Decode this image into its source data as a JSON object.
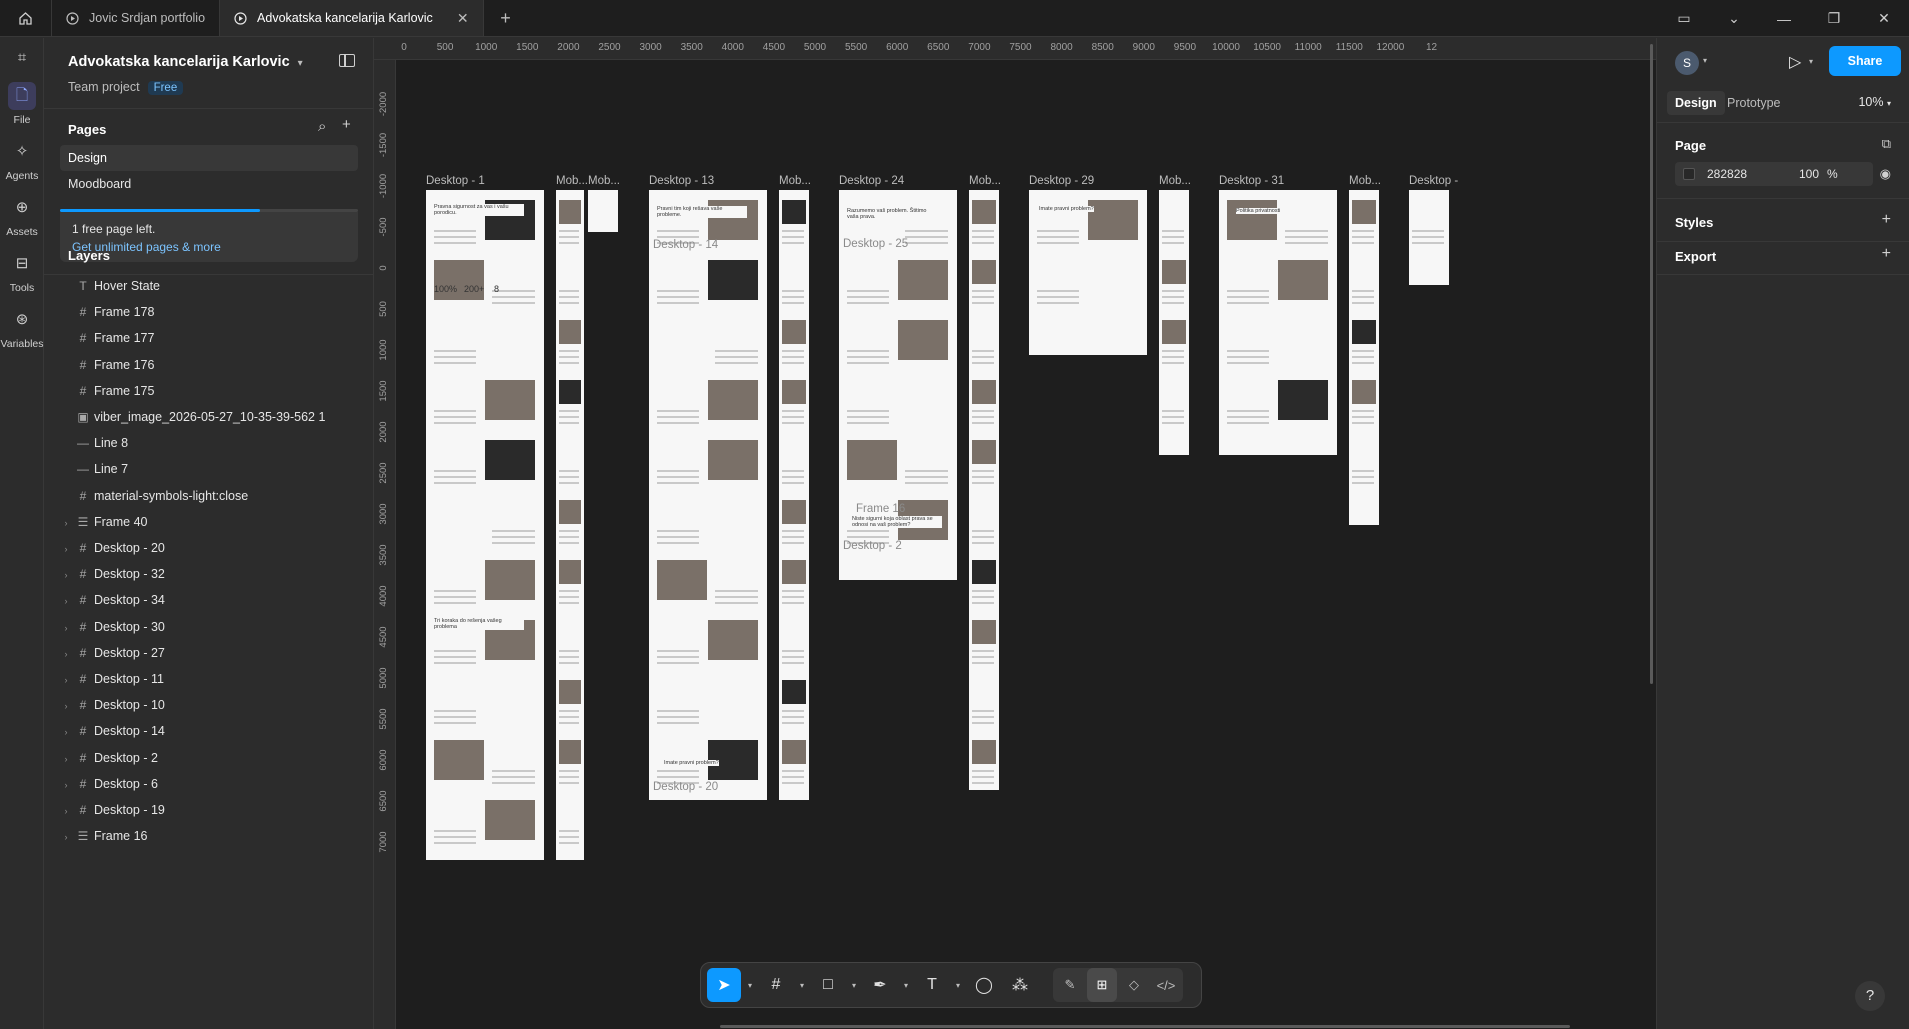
{
  "tabs": [
    {
      "label": "Jovic Srdjan portfolio",
      "active": false
    },
    {
      "label": "Advokatska kancelarija Karlovic",
      "active": true
    }
  ],
  "rail": [
    {
      "label": "File",
      "icon": "file-icon"
    },
    {
      "label": "Agents",
      "icon": "sparkle-icon"
    },
    {
      "label": "Assets",
      "icon": "assets-icon"
    },
    {
      "label": "Tools",
      "icon": "toolbox-icon"
    },
    {
      "label": "Variables",
      "icon": "variables-icon"
    }
  ],
  "project": {
    "title": "Advokatska kancelarija Karlovic",
    "team": "Team project",
    "plan_badge": "Free"
  },
  "pages": {
    "title": "Pages",
    "items": [
      "Design",
      "Moodboard"
    ],
    "active": "Design",
    "usage_fraction": 0.67,
    "notice_line1": "1 free page left.",
    "notice_link": "Get unlimited pages & more"
  },
  "layers": {
    "title": "Layers",
    "items": [
      {
        "name": "Hover State",
        "type": "text",
        "expandable": false
      },
      {
        "name": "Frame 178",
        "type": "frame",
        "expandable": false
      },
      {
        "name": "Frame 177",
        "type": "frame",
        "expandable": false
      },
      {
        "name": "Frame 176",
        "type": "frame",
        "expandable": false
      },
      {
        "name": "Frame 175",
        "type": "frame",
        "expandable": false
      },
      {
        "name": "viber_image_2026-05-27_10-35-39-562 1",
        "type": "image",
        "expandable": false
      },
      {
        "name": "Line 8",
        "type": "line",
        "expandable": false
      },
      {
        "name": "Line 7",
        "type": "line",
        "expandable": false
      },
      {
        "name": "material-symbols-light:close",
        "type": "frame",
        "expandable": false
      },
      {
        "name": "Frame 40",
        "type": "autolayout",
        "expandable": true
      },
      {
        "name": "Desktop - 20",
        "type": "frame",
        "expandable": true
      },
      {
        "name": "Desktop - 32",
        "type": "frame",
        "expandable": true
      },
      {
        "name": "Desktop - 34",
        "type": "frame",
        "expandable": true
      },
      {
        "name": "Desktop - 30",
        "type": "frame",
        "expandable": true
      },
      {
        "name": "Desktop - 27",
        "type": "frame",
        "expandable": true
      },
      {
        "name": "Desktop - 11",
        "type": "frame",
        "expandable": true
      },
      {
        "name": "Desktop - 10",
        "type": "frame",
        "expandable": true
      },
      {
        "name": "Desktop - 14",
        "type": "frame",
        "expandable": true
      },
      {
        "name": "Desktop - 2",
        "type": "frame",
        "expandable": true
      },
      {
        "name": "Desktop - 6",
        "type": "frame",
        "expandable": true
      },
      {
        "name": "Desktop - 19",
        "type": "frame",
        "expandable": true
      },
      {
        "name": "Frame 16",
        "type": "autolayout",
        "expandable": true
      }
    ]
  },
  "ruler": {
    "h": [
      "0",
      "500",
      "1000",
      "1500",
      "2000",
      "2500",
      "3000",
      "3500",
      "4000",
      "4500",
      "5000",
      "5500",
      "6000",
      "6500",
      "7000",
      "7500",
      "8000",
      "8500",
      "9000",
      "9500",
      "10000",
      "10500",
      "11000",
      "11500",
      "12000",
      "12"
    ],
    "v": [
      "-2000",
      "-1500",
      "-1000",
      "-500",
      "0",
      "500",
      "1000",
      "1500",
      "2000",
      "2500",
      "3000",
      "3500",
      "4000",
      "4500",
      "5000",
      "5500",
      "6000",
      "6500",
      "7000"
    ]
  },
  "canvas_frames": {
    "labels": [
      "Desktop - 1",
      "Mob...",
      "Mob...",
      "Desktop - 13",
      "Mob...",
      "Desktop - 24",
      "Mob...",
      "Desktop - 29",
      "Mob...",
      "Desktop - 31",
      "Mob...",
      "Desktop -"
    ],
    "overlay_labels": [
      "Desktop - 14",
      "Desktop - 25",
      "Frame 16",
      "Desktop - 2",
      "Desktop - 20"
    ],
    "content_snippets": {
      "hero_1": "Pravna sigurnost za vas i vašu porodicu.",
      "stats": [
        "100%",
        "200+",
        "8"
      ],
      "hero_13": "Pravni tim koji rešava vaše probleme.",
      "hero_24": "Razumemo vaš problem. Štitimo vaša prava.",
      "contact_29": "Imate pravni problem?",
      "privacy_31": "Politika privatnosti",
      "cta": "Imate pravni problem?",
      "cta_24": "Niste sigurni koja oblast prava se odnosi na vaš problem?",
      "tagline": "Tri koraka do rešenja vašeg problema"
    }
  },
  "toolbar": {
    "tools": [
      "move-icon",
      "frame-icon",
      "rectangle-icon",
      "pen-icon",
      "text-icon",
      "comment-icon",
      "actions-icon"
    ],
    "modes": [
      "draw-mode-icon",
      "design-mode-icon",
      "dev-component-icon",
      "dev-mode-icon"
    ]
  },
  "right": {
    "avatar_initial": "S",
    "share_label": "Share",
    "tabs": [
      "Design",
      "Prototype"
    ],
    "active_tab": "Design",
    "zoom": "10%",
    "page_section": "Page",
    "bg_color_hex": "282828",
    "bg_opacity": "100",
    "bg_opacity_unit": "%",
    "styles_section": "Styles",
    "export_section": "Export",
    "help": "?"
  },
  "colors": {
    "accent": "#0d99ff",
    "ui_bg": "#2c2c2c",
    "canvas_bg": "#1e1e1e",
    "frame_bg": "#f7f7f7",
    "dark_section": "#2a2a2a"
  }
}
